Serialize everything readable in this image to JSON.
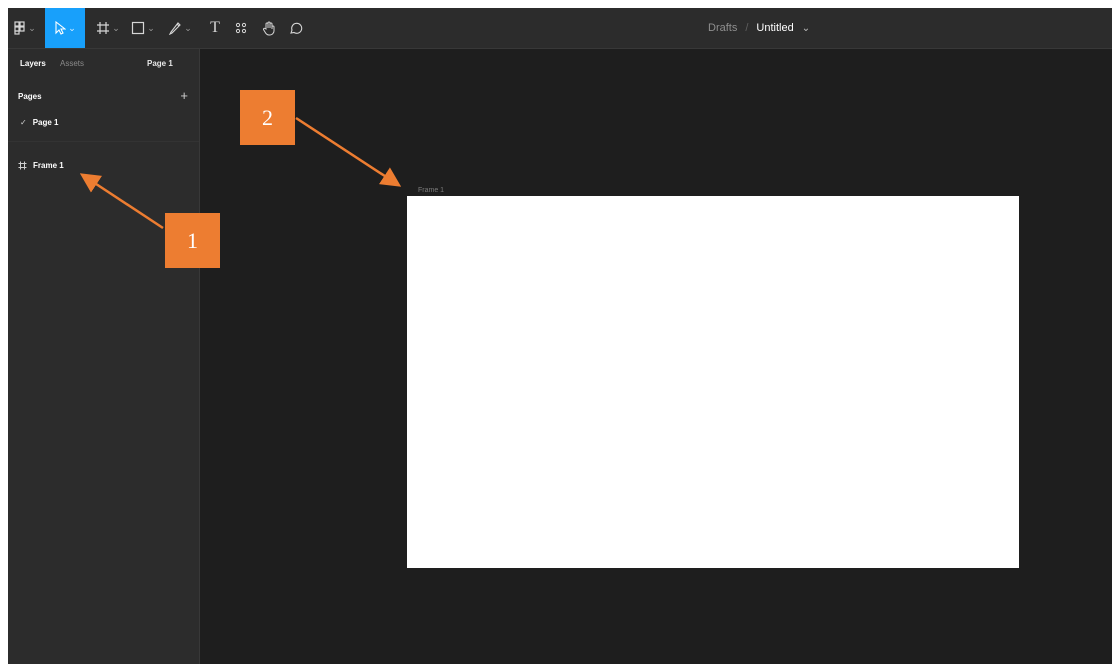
{
  "toolbar": {
    "tools": [
      {
        "name": "main-menu",
        "icon": "grid-menu-icon",
        "has_dropdown": true
      },
      {
        "name": "move",
        "icon": "cursor-icon",
        "has_dropdown": true,
        "active": true
      },
      {
        "name": "frame",
        "icon": "frame-icon",
        "has_dropdown": true
      },
      {
        "name": "shape",
        "icon": "rectangle-icon",
        "has_dropdown": true
      },
      {
        "name": "pen",
        "icon": "pen-icon",
        "has_dropdown": true
      },
      {
        "name": "text",
        "icon": "text-icon",
        "label": "T"
      },
      {
        "name": "resources",
        "icon": "resources-icon"
      },
      {
        "name": "hand",
        "icon": "hand-icon"
      },
      {
        "name": "comment",
        "icon": "comment-icon"
      }
    ],
    "dropdown_caret": "⌄",
    "active_color": "#18a0fb"
  },
  "breadcrumb": {
    "parent": "Drafts",
    "separator": "/",
    "file": "Untitled",
    "chevron": "⌄"
  },
  "left_panel": {
    "tabs": {
      "layers": "Layers",
      "assets": "Assets",
      "page": "Page 1"
    },
    "pages_title": "Pages",
    "add_page": "+",
    "pages": [
      {
        "label": "Page 1",
        "selected": true,
        "check": "✓"
      }
    ],
    "layers": [
      {
        "label": "Frame 1",
        "icon": "frame-icon"
      }
    ]
  },
  "canvas": {
    "background": "#1e1e1e",
    "frame": {
      "name": "Frame 1",
      "fill": "#ffffff"
    }
  },
  "annotations": {
    "color": "#ed7d31",
    "items": [
      {
        "number": "1",
        "target": "Frame 1 layer"
      },
      {
        "number": "2",
        "target": "Frame 1 on canvas"
      }
    ]
  }
}
